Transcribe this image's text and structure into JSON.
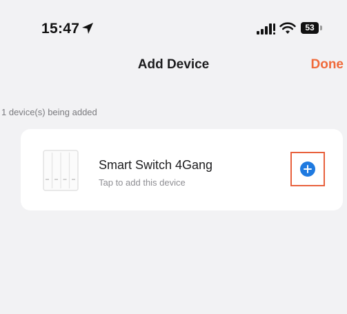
{
  "status_bar": {
    "time": "15:47",
    "battery": "53"
  },
  "nav": {
    "title": "Add Device",
    "done_label": "Done"
  },
  "section_caption": "1 device(s) being added",
  "device": {
    "name": "Smart Switch 4Gang",
    "hint": "Tap to add this device"
  },
  "colors": {
    "accent": "#f06a3a",
    "add_button": "#1f7ae0",
    "background": "#f2f2f4",
    "card": "#ffffff"
  },
  "icons": {
    "location": "location-arrow-icon",
    "signal": "cellular-signal-icon",
    "wifi": "wifi-icon",
    "add": "plus-circle-icon"
  }
}
